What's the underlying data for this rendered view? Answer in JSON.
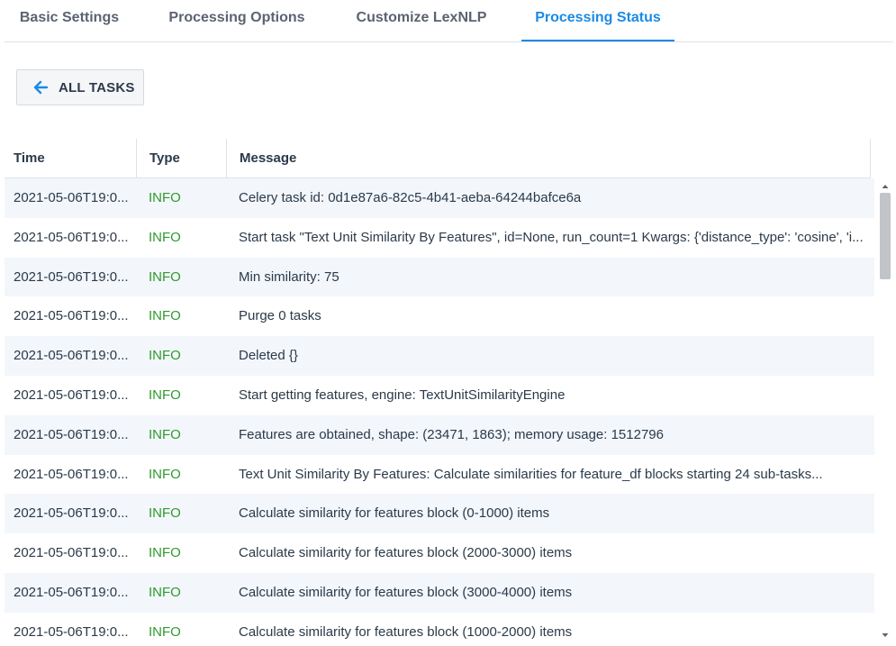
{
  "tabs": [
    {
      "label": "Basic Settings"
    },
    {
      "label": "Processing Options"
    },
    {
      "label": "Customize LexNLP"
    },
    {
      "label": "Processing Status"
    }
  ],
  "back_button": {
    "label": "ALL TASKS",
    "icon": "arrow-left-icon"
  },
  "colors": {
    "accent": "#1a8ae6",
    "info": "#2e9a2e"
  },
  "table": {
    "headers": {
      "time": "Time",
      "type": "Type",
      "message": "Message"
    },
    "rows": [
      {
        "time": "2021-05-06T19:0...",
        "type": "INFO",
        "message": "Celery task id: 0d1e87a6-82c5-4b41-aeba-64244bafce6a"
      },
      {
        "time": "2021-05-06T19:0...",
        "type": "INFO",
        "message": "Start task \"Text Unit Similarity By Features\", id=None, run_count=1 Kwargs: {'distance_type': 'cosine', 'i..."
      },
      {
        "time": "2021-05-06T19:0...",
        "type": "INFO",
        "message": "Min similarity: 75"
      },
      {
        "time": "2021-05-06T19:0...",
        "type": "INFO",
        "message": "Purge 0 tasks"
      },
      {
        "time": "2021-05-06T19:0...",
        "type": "INFO",
        "message": "Deleted {}"
      },
      {
        "time": "2021-05-06T19:0...",
        "type": "INFO",
        "message": "Start getting features, engine: TextUnitSimilarityEngine"
      },
      {
        "time": "2021-05-06T19:0...",
        "type": "INFO",
        "message": "Features are obtained, shape: (23471, 1863); memory usage: 1512796"
      },
      {
        "time": "2021-05-06T19:0...",
        "type": "INFO",
        "message": "Text Unit Similarity By Features: Calculate similarities for feature_df blocks starting 24 sub-tasks..."
      },
      {
        "time": "2021-05-06T19:0...",
        "type": "INFO",
        "message": "Calculate similarity for features block (0-1000) items"
      },
      {
        "time": "2021-05-06T19:0...",
        "type": "INFO",
        "message": "Calculate similarity for features block (2000-3000) items"
      },
      {
        "time": "2021-05-06T19:0...",
        "type": "INFO",
        "message": "Calculate similarity for features block (3000-4000) items"
      },
      {
        "time": "2021-05-06T19:0...",
        "type": "INFO",
        "message": "Calculate similarity for features block (1000-2000) items"
      }
    ]
  }
}
